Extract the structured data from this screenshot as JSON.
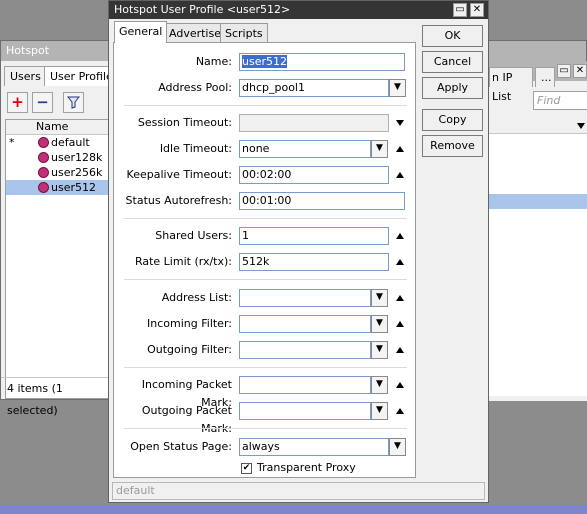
{
  "background_window": {
    "title": "Hotspot",
    "tabs": [
      "Users",
      "User Profiles",
      "n IP List",
      "..."
    ],
    "find_placeholder": "Find",
    "list": {
      "header": "Name",
      "rows": [
        {
          "marker": "*",
          "name": "default"
        },
        {
          "marker": "",
          "name": "user128k"
        },
        {
          "marker": "",
          "name": "user256k"
        },
        {
          "marker": "",
          "name": "user512"
        }
      ]
    },
    "status": "4 items (1 selected)"
  },
  "dialog": {
    "title": "Hotspot User Profile <user512>",
    "tabs": [
      "General",
      "Advertise",
      "Scripts"
    ],
    "fields": {
      "name": {
        "label": "Name:",
        "value": "user512"
      },
      "address_pool": {
        "label": "Address Pool:",
        "value": "dhcp_pool1"
      },
      "session_timeout": {
        "label": "Session Timeout:",
        "value": ""
      },
      "idle_timeout": {
        "label": "Idle Timeout:",
        "value": "none"
      },
      "keepalive_timeout": {
        "label": "Keepalive Timeout:",
        "value": "00:02:00"
      },
      "status_autorefresh": {
        "label": "Status Autorefresh:",
        "value": "00:01:00"
      },
      "shared_users": {
        "label": "Shared Users:",
        "value": "1"
      },
      "rate_limit": {
        "label": "Rate Limit (rx/tx):",
        "value": "512k"
      },
      "address_list": {
        "label": "Address List:",
        "value": ""
      },
      "incoming_filter": {
        "label": "Incoming Filter:",
        "value": ""
      },
      "outgoing_filter": {
        "label": "Outgoing Filter:",
        "value": ""
      },
      "incoming_packet_mark": {
        "label": "Incoming Packet Mark:",
        "value": ""
      },
      "outgoing_packet_mark": {
        "label": "Outgoing Packet Mark:",
        "value": ""
      },
      "open_status_page": {
        "label": "Open Status Page:",
        "value": "always"
      },
      "transparent_proxy": {
        "label": "Transparent Proxy",
        "checked": true
      }
    },
    "buttons": [
      "OK",
      "Cancel",
      "Apply",
      "Copy",
      "Remove"
    ],
    "status": "default"
  }
}
